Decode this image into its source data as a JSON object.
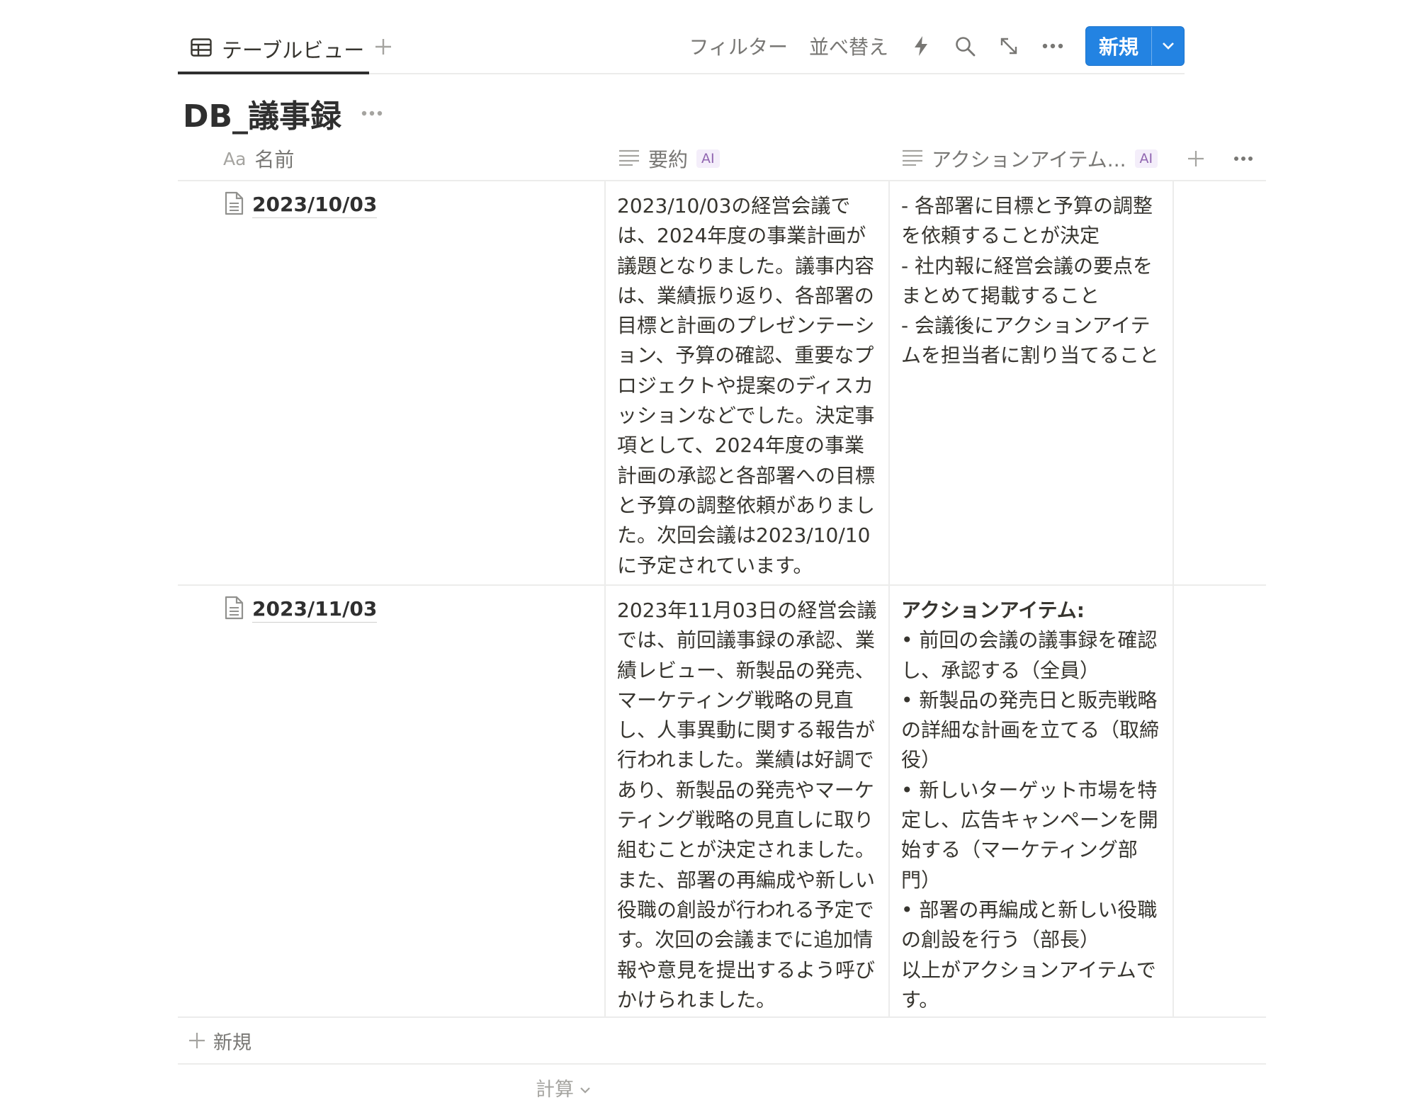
{
  "view": {
    "tab_label": "テーブルビュー"
  },
  "toolbar": {
    "filter": "フィルター",
    "sort": "並べ替え",
    "new_label": "新規"
  },
  "page": {
    "title": "DB_議事録"
  },
  "columns": {
    "name": "名前",
    "name_prefix": "Aa",
    "summary": "要約",
    "actions": "アクションアイテム...",
    "ai_badge": "AI"
  },
  "rows": [
    {
      "name": "2023/10/03",
      "summary": "2023/10/03の経営会議では、2024年度の事業計画が議題となりました。議事内容は、業績振り返り、各部署の目標と計画のプレゼンテーション、予算の確認、重要なプロジェクトや提案のディスカッションなどでした。決定事項として、2024年度の事業計画の承認と各部署への目標と予算の調整依頼がありました。次回会議は2023/10/10に予定されています。",
      "actions": "- 各部署に目標と予算の調整を依頼することが決定\n- 社内報に経営会議の要点をまとめて掲載すること\n- 会議後にアクションアイテムを担当者に割り当てること"
    },
    {
      "name": "2023/11/03",
      "summary": "2023年11月03日の経営会議では、前回議事録の承認、業績レビュー、新製品の発売、マーケティング戦略の見直し、人事異動に関する報告が行われました。業績は好調であり、新製品の発売やマーケティング戦略の見直しに取り組むことが決定されました。また、部署の再編成や新しい役職の創設が行われる予定です。次回の会議までに追加情報や意見を提出するよう呼びかけられました。",
      "actions_heading": "アクションアイテム:",
      "actions": "• 前回の会議の議事録を確認し、承認する（全員）\n• 新製品の発売日と販売戦略の詳細な計画を立てる（取締役）\n• 新しいターゲット市場を特定し、広告キャンペーンを開始する（マーケティング部門）\n• 部署の再編成と新しい役職の創設を行う（部長）\n以上がアクションアイテムです。"
    }
  ],
  "footer": {
    "add_new": "新規",
    "calculate": "計算"
  }
}
